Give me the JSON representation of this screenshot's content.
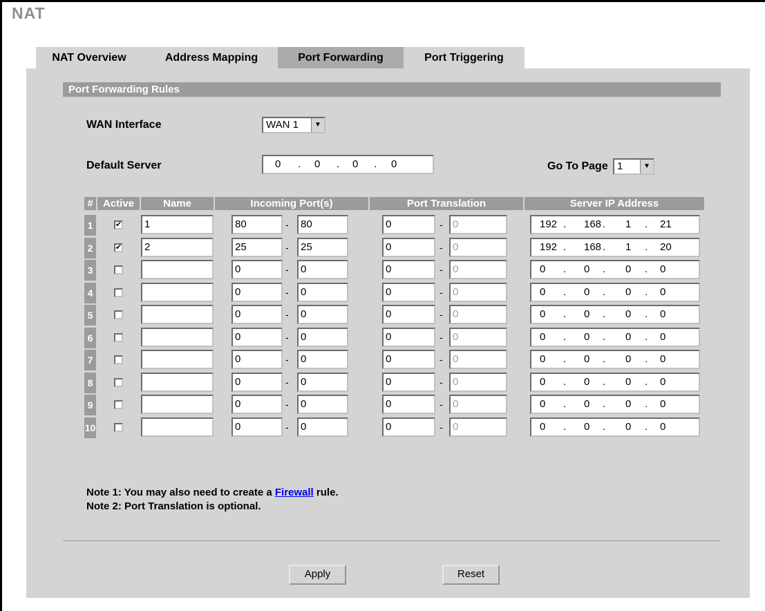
{
  "title": "NAT",
  "tabs": [
    {
      "label": "NAT Overview"
    },
    {
      "label": "Address Mapping"
    },
    {
      "label": "Port Forwarding",
      "active": true
    },
    {
      "label": "Port Triggering"
    }
  ],
  "section_title": "Port Forwarding Rules",
  "wan_interface": {
    "label": "WAN Interface",
    "value": "WAN 1"
  },
  "default_server": {
    "label": "Default Server",
    "ip": [
      "0",
      "0",
      "0",
      "0"
    ]
  },
  "go_to_page": {
    "label": "Go To Page",
    "value": "1"
  },
  "table": {
    "headers": {
      "num": "#",
      "active": "Active",
      "name": "Name",
      "incoming": "Incoming Port(s)",
      "translation": "Port Translation",
      "server_ip": "Server IP Address"
    },
    "rows": [
      {
        "num": "1",
        "active": true,
        "name": "1",
        "in_start": "80",
        "in_end": "80",
        "tr_start": "0",
        "tr_end": "0",
        "ip": [
          "192",
          "168",
          "1",
          "21"
        ]
      },
      {
        "num": "2",
        "active": true,
        "name": "2",
        "in_start": "25",
        "in_end": "25",
        "tr_start": "0",
        "tr_end": "0",
        "ip": [
          "192",
          "168",
          "1",
          "20"
        ]
      },
      {
        "num": "3",
        "active": false,
        "name": "",
        "in_start": "0",
        "in_end": "0",
        "tr_start": "0",
        "tr_end": "0",
        "ip": [
          "0",
          "0",
          "0",
          "0"
        ]
      },
      {
        "num": "4",
        "active": false,
        "name": "",
        "in_start": "0",
        "in_end": "0",
        "tr_start": "0",
        "tr_end": "0",
        "ip": [
          "0",
          "0",
          "0",
          "0"
        ]
      },
      {
        "num": "5",
        "active": false,
        "name": "",
        "in_start": "0",
        "in_end": "0",
        "tr_start": "0",
        "tr_end": "0",
        "ip": [
          "0",
          "0",
          "0",
          "0"
        ]
      },
      {
        "num": "6",
        "active": false,
        "name": "",
        "in_start": "0",
        "in_end": "0",
        "tr_start": "0",
        "tr_end": "0",
        "ip": [
          "0",
          "0",
          "0",
          "0"
        ]
      },
      {
        "num": "7",
        "active": false,
        "name": "",
        "in_start": "0",
        "in_end": "0",
        "tr_start": "0",
        "tr_end": "0",
        "ip": [
          "0",
          "0",
          "0",
          "0"
        ]
      },
      {
        "num": "8",
        "active": false,
        "name": "",
        "in_start": "0",
        "in_end": "0",
        "tr_start": "0",
        "tr_end": "0",
        "ip": [
          "0",
          "0",
          "0",
          "0"
        ]
      },
      {
        "num": "9",
        "active": false,
        "name": "",
        "in_start": "0",
        "in_end": "0",
        "tr_start": "0",
        "tr_end": "0",
        "ip": [
          "0",
          "0",
          "0",
          "0"
        ]
      },
      {
        "num": "10",
        "active": false,
        "name": "",
        "in_start": "0",
        "in_end": "0",
        "tr_start": "0",
        "tr_end": "0",
        "ip": [
          "0",
          "0",
          "0",
          "0"
        ]
      }
    ]
  },
  "notes": {
    "note1_prefix": "Note 1: You may also need to create a ",
    "note1_link": "Firewall",
    "note1_suffix": " rule.",
    "note2": "Note 2: Port Translation is optional."
  },
  "buttons": {
    "apply": "Apply",
    "reset": "Reset"
  },
  "colors": {
    "link": "#0000ee",
    "header_bg": "#9b9b9b",
    "panel_bg": "#d4d4d4",
    "title": "#8f8f8f"
  },
  "icons": {
    "dropdown_arrow": "down-triangle",
    "check": "checkmark"
  }
}
